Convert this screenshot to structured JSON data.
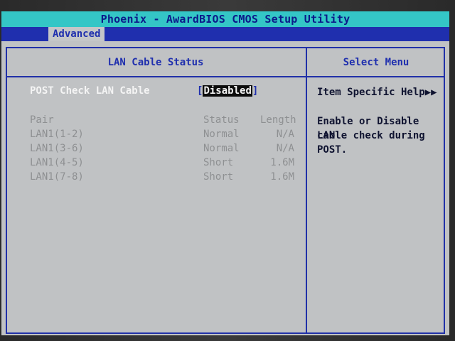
{
  "title": "Phoenix - AwardBIOS CMOS Setup Utility",
  "menu": {
    "active_tab": "Advanced"
  },
  "panel": {
    "left_header": "LAN Cable Status",
    "right_header": "Select Menu"
  },
  "setting": {
    "label": "POST Check LAN Cable",
    "bracket_open": "[",
    "value": "Disabled",
    "bracket_close": "]"
  },
  "table": {
    "headers": {
      "pair": "Pair",
      "status": "Status",
      "length": "Length"
    },
    "rows": [
      {
        "pair": "LAN1(1-2)",
        "status": "Normal",
        "length": "N/A"
      },
      {
        "pair": "LAN1(3-6)",
        "status": "Normal",
        "length": "N/A"
      },
      {
        "pair": "LAN1(4-5)",
        "status": "Short",
        "length": "1.6M"
      },
      {
        "pair": "LAN1(7-8)",
        "status": "Short",
        "length": "1.6M"
      }
    ]
  },
  "help": {
    "title": "Item Specific Help▶▶",
    "text_line1": "Enable or Disable LAN",
    "text_line2": "cable check during",
    "text_line3": "POST."
  },
  "colors": {
    "title_bg": "#34c6c6",
    "menu_bg": "#1f2fae",
    "panel_bg": "#c0c2c4",
    "accent_blue": "#1f2fae"
  }
}
